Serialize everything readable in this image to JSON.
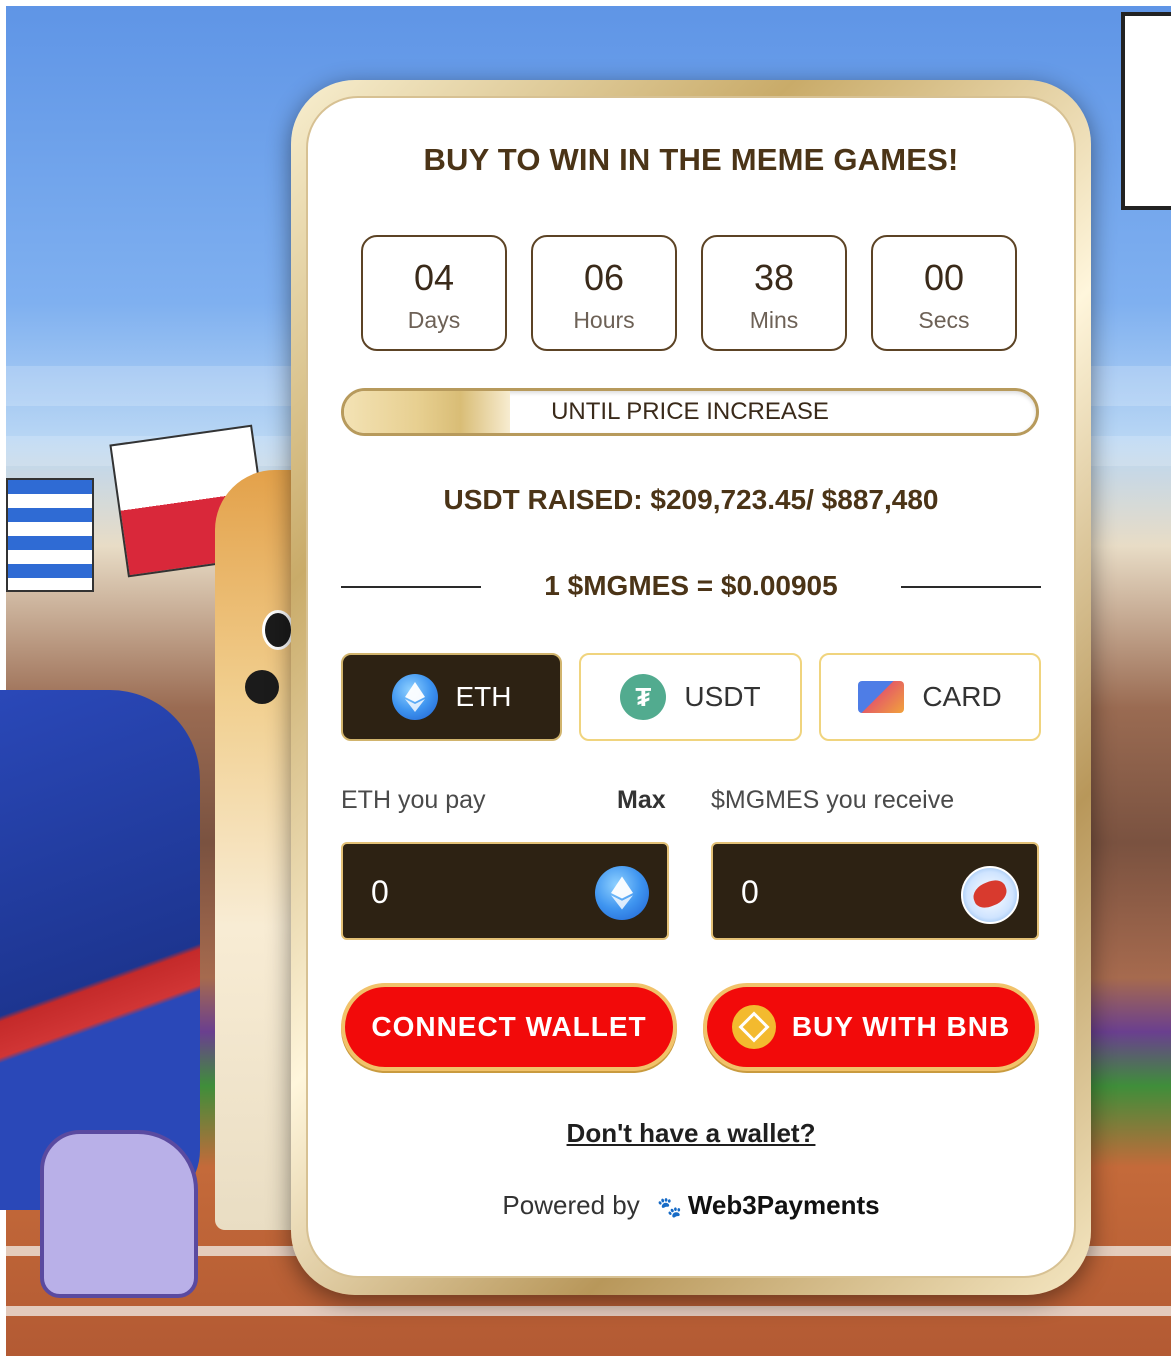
{
  "title": "BUY TO WIN IN THE MEME GAMES!",
  "countdown": [
    {
      "value": "04",
      "label": "Days"
    },
    {
      "value": "06",
      "label": "Hours"
    },
    {
      "value": "38",
      "label": "Mins"
    },
    {
      "value": "00",
      "label": "Secs"
    }
  ],
  "progress": {
    "label": "UNTIL PRICE INCREASE",
    "fraction": 0.24
  },
  "raised_text": "USDT RAISED: $209,723.45/ $887,480",
  "price_text": "1 $MGMES = $0.00905",
  "payment_methods": [
    {
      "label": "ETH",
      "icon": "eth-coin-icon",
      "active": true
    },
    {
      "label": "USDT",
      "icon": "usdt-coin-icon",
      "active": false
    },
    {
      "label": "CARD",
      "icon": "credit-card-icon",
      "active": false
    }
  ],
  "pay_field": {
    "label": "ETH you pay",
    "max_label": "Max",
    "value": "0",
    "icon": "eth-coin-icon"
  },
  "receive_field": {
    "label": "$MGMES you receive",
    "value": "0",
    "icon": "mgmes-token-icon"
  },
  "buttons": {
    "connect": "CONNECT WALLET",
    "buy_bnb": "BUY WITH BNB"
  },
  "no_wallet_link": "Don't have a wallet?",
  "powered_by": {
    "prefix": "Powered by",
    "brand": "Web3Payments"
  },
  "colors": {
    "dark_brown": "#2d2213",
    "accent_red": "#f20a0a",
    "gold": "#d1b46d",
    "text_brown": "#4b3417"
  }
}
